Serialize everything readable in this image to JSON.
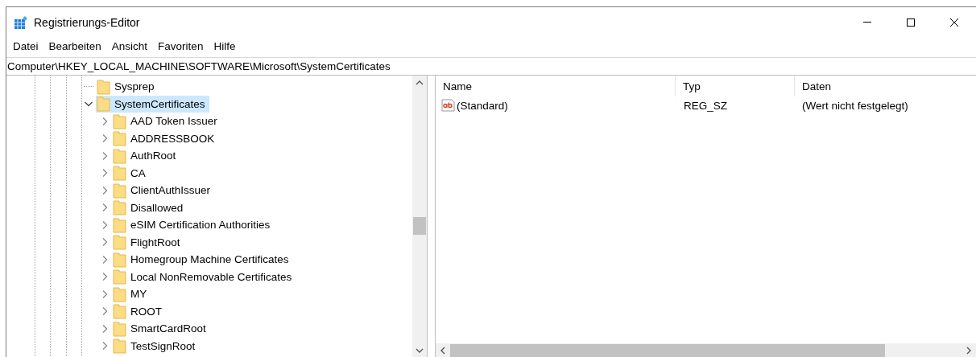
{
  "window": {
    "title": "Registrierungs-Editor"
  },
  "menu": [
    "Datei",
    "Bearbeiten",
    "Ansicht",
    "Favoriten",
    "Hilfe"
  ],
  "address": "Computer\\HKEY_LOCAL_MACHINE\\SOFTWARE\\Microsoft\\SystemCertificates",
  "tree": [
    {
      "label": "Sysprep",
      "expandable": false,
      "selected": false
    },
    {
      "label": "SystemCertificates",
      "expandable": true,
      "expanded": true,
      "selected": true,
      "children": [
        {
          "label": "AAD Token Issuer",
          "expandable": true,
          "expanded": false,
          "selected": false
        },
        {
          "label": "ADDRESSBOOK",
          "expandable": true,
          "expanded": false,
          "selected": false
        },
        {
          "label": "AuthRoot",
          "expandable": true,
          "expanded": false,
          "selected": false
        },
        {
          "label": "CA",
          "expandable": true,
          "expanded": false,
          "selected": false
        },
        {
          "label": "ClientAuthIssuer",
          "expandable": true,
          "expanded": false,
          "selected": false
        },
        {
          "label": "Disallowed",
          "expandable": true,
          "expanded": false,
          "selected": false
        },
        {
          "label": "eSIM Certification Authorities",
          "expandable": true,
          "expanded": false,
          "selected": false
        },
        {
          "label": "FlightRoot",
          "expandable": true,
          "expanded": false,
          "selected": false
        },
        {
          "label": "Homegroup Machine Certificates",
          "expandable": true,
          "expanded": false,
          "selected": false
        },
        {
          "label": "Local NonRemovable Certificates",
          "expandable": true,
          "expanded": false,
          "selected": false
        },
        {
          "label": "MY",
          "expandable": true,
          "expanded": false,
          "selected": false
        },
        {
          "label": "ROOT",
          "expandable": true,
          "expanded": false,
          "selected": false
        },
        {
          "label": "SmartCardRoot",
          "expandable": true,
          "expanded": false,
          "selected": false
        },
        {
          "label": "TestSignRoot",
          "expandable": true,
          "expanded": false,
          "selected": false
        }
      ]
    }
  ],
  "values": {
    "columns": [
      "Name",
      "Typ",
      "Daten"
    ],
    "rows": [
      {
        "name": "(Standard)",
        "type": "REG_SZ",
        "data": "(Wert nicht festgelegt)"
      }
    ]
  }
}
